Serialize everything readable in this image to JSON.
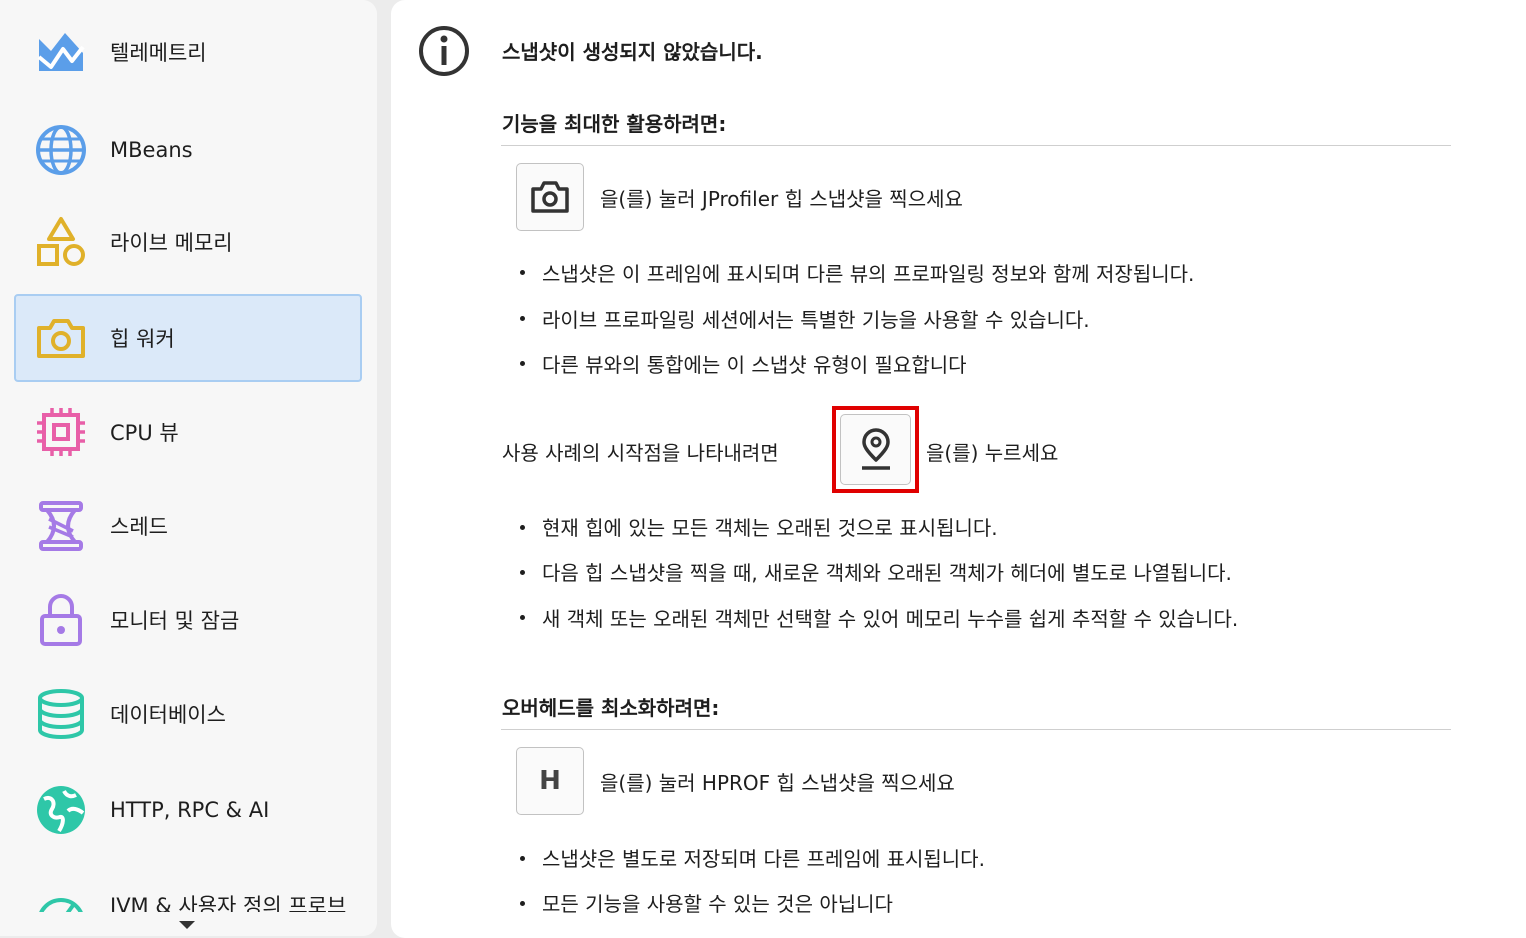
{
  "sidebar": {
    "items": [
      {
        "label": "텔레메트리",
        "icon": "telemetry-icon",
        "color": "#5b9ee9"
      },
      {
        "label": "MBeans",
        "icon": "globe-icon",
        "color": "#5b9ee9"
      },
      {
        "label": "라이브 메모리",
        "icon": "shapes-icon",
        "color": "#e0b12a"
      },
      {
        "label": "힙 워커",
        "icon": "camera-icon",
        "color": "#e0b12a",
        "selected": true
      },
      {
        "label": "CPU 뷰",
        "icon": "chip-icon",
        "color": "#e85fa8"
      },
      {
        "label": "스레드",
        "icon": "spool-icon",
        "color": "#a57ae6"
      },
      {
        "label": "모니터 및 잠금",
        "icon": "lock-icon",
        "color": "#a57ae6"
      },
      {
        "label": "데이터베이스",
        "icon": "database-icon",
        "color": "#2ec7a8"
      },
      {
        "label": "HTTP, RPC & AI",
        "icon": "network-globe-icon",
        "color": "#2ec7a8"
      },
      {
        "label": "JVM & 사용자 정의 프로브",
        "icon": "gauge-icon",
        "color": "#2ec7a8"
      }
    ],
    "scroll_indicator": "chevron-down-icon"
  },
  "main": {
    "title": "스냅샷이 생성되지 않았습니다.",
    "section1": {
      "heading": "기능을 최대한 활용하려면:",
      "action_text": "을(를) 눌러 JProfiler 힙 스냅샷을 찍으세요",
      "bullets": [
        "스냅샷은 이 프레임에 표시되며 다른 뷰의 프로파일링 정보와 함께 저장됩니다.",
        "라이브 프로파일링 세션에서는 특별한 기능을 사용할 수 있습니다.",
        "다른 뷰와의 통합에는 이 스냅샷 유형이 필요합니다"
      ],
      "mark_prefix": "사용 사례의 시작점을 나타내려면",
      "mark_suffix": "을(를) 누르세요",
      "mark_bullets": [
        "현재 힙에 있는 모든 객체는 오래된 것으로 표시됩니다.",
        "다음 힙 스냅샷을 찍을 때, 새로운 객체와 오래된 객체가 헤더에 별도로 나열됩니다.",
        "새 객체 또는 오래된 객체만 선택할 수 있어 메모리 누수를 쉽게 추적할 수 있습니다."
      ]
    },
    "section2": {
      "heading": "오버헤드를 최소화하려면:",
      "button_label": "H",
      "action_text": "을(를) 눌러 HPROF 힙 스냅샷을 찍으세요",
      "bullets": [
        "스냅샷은 별도로 저장되며 다른 프레임에 표시됩니다.",
        "모든 기능을 사용할 수 있는 것은 아닙니다"
      ]
    },
    "highlight_color": "#e00000"
  }
}
